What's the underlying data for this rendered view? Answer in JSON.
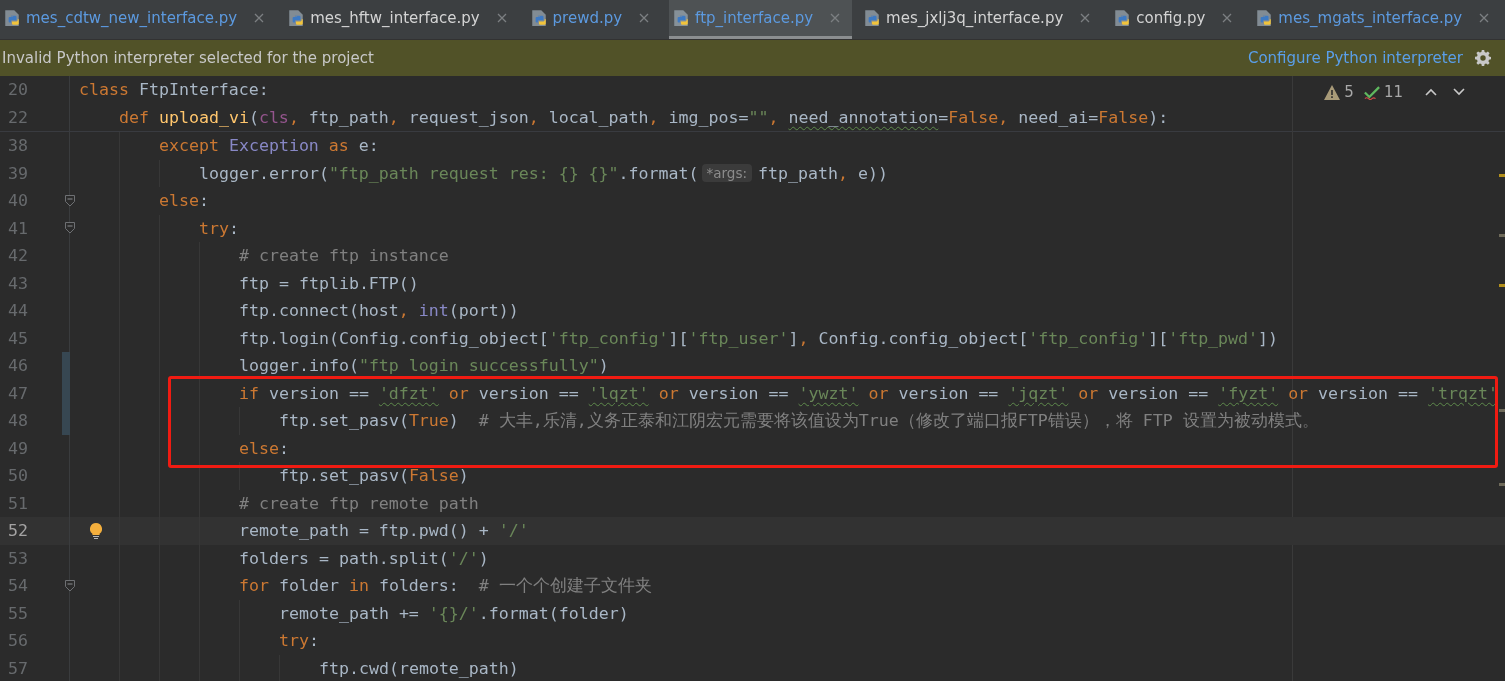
{
  "tabs": [
    {
      "label": "mes_cdtw_new_interface.py",
      "selected": false,
      "color": "#5c9ae0"
    },
    {
      "label": "mes_hftw_interface.py",
      "selected": false,
      "color": "#d4d4d4"
    },
    {
      "label": "prewd.py",
      "selected": false,
      "color": "#5c9ae0"
    },
    {
      "label": "ftp_interface.py",
      "selected": true,
      "color": "#5c9ae0"
    },
    {
      "label": "mes_jxlj3q_interface.py",
      "selected": false,
      "color": "#d4d4d4"
    },
    {
      "label": "config.py",
      "selected": false,
      "color": "#d4d4d4"
    },
    {
      "label": "mes_mgats_interface.py",
      "selected": false,
      "color": "#5c9ae0"
    }
  ],
  "banner": {
    "message": "Invalid Python interpreter selected for the project",
    "link": "Configure Python interpreter"
  },
  "inspections": {
    "warnings": "5",
    "checks": "11"
  },
  "sticky_lines": [
    {
      "number": "20",
      "tokens": [
        {
          "text": "class",
          "kind": "kw"
        },
        {
          "text": " FtpInterface:",
          "kind": "plain"
        }
      ],
      "children": [
        {
          "number": "22",
          "tokens": [
            {
              "text": "def",
              "kind": "kw"
            },
            {
              "text": " upload_vi",
              "kind": "fn"
            },
            {
              "text": "(",
              "kind": "plain"
            },
            {
              "text": "cls",
              "kind": "self"
            },
            {
              "text": ",",
              "kind": "kw"
            },
            {
              "text": " ftp_path",
              "kind": "plain"
            },
            {
              "text": ",",
              "kind": "kw"
            },
            {
              "text": " request_json",
              "kind": "plain"
            },
            {
              "text": ",",
              "kind": "kw"
            },
            {
              "text": " local_path",
              "kind": "plain"
            },
            {
              "text": ",",
              "kind": "kw"
            },
            {
              "text": " img_pos=",
              "kind": "plain"
            },
            {
              "text": "\"\"",
              "kind": "str"
            },
            {
              "text": ", ",
              "kind": "kw"
            },
            {
              "text": "need_annotation",
              "kind": "plain",
              "squiggle": true
            },
            {
              "text": "=",
              "kind": "plain"
            },
            {
              "text": "False",
              "kind": "kw"
            },
            {
              "text": ",",
              "kind": "kw"
            },
            {
              "text": " need_ai=",
              "kind": "plain"
            },
            {
              "text": "False",
              "kind": "kw"
            },
            {
              "text": "):",
              "kind": "plain"
            }
          ]
        }
      ]
    }
  ],
  "lines": [
    {
      "number": "38",
      "fold": false,
      "changed": false,
      "current": false,
      "bulb": false,
      "tokens": [
        {
          "text": "except",
          "kind": "kw"
        },
        {
          "text": " Exception",
          "kind": "builtin"
        },
        {
          "text": " as",
          "kind": "kw"
        },
        {
          "text": " e:",
          "kind": "plain"
        }
      ],
      "children": [
        {
          "number": "39",
          "fold": false,
          "changed": false,
          "current": false,
          "bulb": false,
          "tokens": [
            {
              "text": "logger.error(",
              "kind": "plain"
            },
            {
              "text": "\"ftp_path request res: {} {}\"",
              "kind": "str"
            },
            {
              "text": ".format(",
              "kind": "plain"
            },
            {
              "text": "*args:",
              "kind": "hint"
            },
            {
              "text": "ftp_path",
              "kind": "plain"
            },
            {
              "text": ",",
              "kind": "kw"
            },
            {
              "text": " e))",
              "kind": "plain"
            }
          ]
        }
      ]
    },
    {
      "number": "40",
      "fold": true,
      "changed": false,
      "current": false,
      "bulb": false,
      "tokens": [
        {
          "text": "else",
          "kind": "kw"
        },
        {
          "text": ":",
          "kind": "plain"
        }
      ],
      "children": [
        {
          "number": "41",
          "fold": true,
          "changed": false,
          "current": false,
          "bulb": false,
          "tokens": [
            {
              "text": "try",
              "kind": "kw"
            },
            {
              "text": ":",
              "kind": "plain"
            }
          ],
          "children": [
            {
              "number": "42",
              "fold": false,
              "changed": false,
              "current": false,
              "bulb": false,
              "tokens": [
                {
                  "text": "# create ftp instance",
                  "kind": "cmt"
                }
              ]
            },
            {
              "number": "43",
              "fold": false,
              "changed": false,
              "current": false,
              "bulb": false,
              "tokens": [
                {
                  "text": "ftp = ftplib.FTP()",
                  "kind": "plain"
                }
              ]
            },
            {
              "number": "44",
              "fold": false,
              "changed": false,
              "current": false,
              "bulb": false,
              "tokens": [
                {
                  "text": "ftp.connect(host",
                  "kind": "plain"
                },
                {
                  "text": ",",
                  "kind": "kw"
                },
                {
                  "text": " int",
                  "kind": "builtin"
                },
                {
                  "text": "(port))",
                  "kind": "plain"
                }
              ]
            },
            {
              "number": "45",
              "fold": false,
              "changed": false,
              "current": false,
              "bulb": false,
              "tokens": [
                {
                  "text": "ftp.login(Config.config_object[",
                  "kind": "plain"
                },
                {
                  "text": "'ftp_config'",
                  "kind": "str"
                },
                {
                  "text": "][",
                  "kind": "plain"
                },
                {
                  "text": "'ftp_user'",
                  "kind": "str"
                },
                {
                  "text": "]",
                  "kind": "plain"
                },
                {
                  "text": ",",
                  "kind": "kw"
                },
                {
                  "text": " Config.config_object[",
                  "kind": "plain"
                },
                {
                  "text": "'ftp_config'",
                  "kind": "str"
                },
                {
                  "text": "][",
                  "kind": "plain"
                },
                {
                  "text": "'ftp_pwd'",
                  "kind": "str"
                },
                {
                  "text": "])",
                  "kind": "plain"
                }
              ]
            },
            {
              "number": "46",
              "fold": false,
              "changed": true,
              "current": false,
              "bulb": false,
              "tokens": [
                {
                  "text": "logger.info(",
                  "kind": "plain"
                },
                {
                  "text": "\"ftp login successfully\"",
                  "kind": "str"
                },
                {
                  "text": ")",
                  "kind": "plain"
                }
              ]
            },
            {
              "number": "47",
              "fold": false,
              "changed": true,
              "current": false,
              "bulb": false,
              "tokens": [
                {
                  "text": "if",
                  "kind": "kw"
                },
                {
                  "text": " version == ",
                  "kind": "plain"
                },
                {
                  "text": "'dfzt'",
                  "kind": "str",
                  "squiggle": true
                },
                {
                  "text": " or",
                  "kind": "kw"
                },
                {
                  "text": " version == ",
                  "kind": "plain"
                },
                {
                  "text": "'lqzt'",
                  "kind": "str",
                  "squiggle": true
                },
                {
                  "text": " or",
                  "kind": "kw"
                },
                {
                  "text": " version == ",
                  "kind": "plain"
                },
                {
                  "text": "'ywzt'",
                  "kind": "str",
                  "squiggle": true
                },
                {
                  "text": " or",
                  "kind": "kw"
                },
                {
                  "text": " version == ",
                  "kind": "plain"
                },
                {
                  "text": "'jqzt'",
                  "kind": "str",
                  "squiggle": true
                },
                {
                  "text": " or",
                  "kind": "kw"
                },
                {
                  "text": " version == ",
                  "kind": "plain"
                },
                {
                  "text": "'fyzt'",
                  "kind": "str",
                  "squiggle": true
                },
                {
                  "text": " or",
                  "kind": "kw"
                },
                {
                  "text": " version == ",
                  "kind": "plain"
                },
                {
                  "text": "'trqzt'",
                  "kind": "str",
                  "squiggle": true
                }
              ],
              "children": [
                {
                  "number": "48",
                  "fold": false,
                  "changed": true,
                  "current": false,
                  "bulb": false,
                  "tokens": [
                    {
                      "text": "ftp.set_pasv(",
                      "kind": "plain"
                    },
                    {
                      "text": "True",
                      "kind": "kw"
                    },
                    {
                      "text": ")  ",
                      "kind": "plain"
                    },
                    {
                      "text": "# 大丰,乐清,义务正泰和江阴宏元需要将该值设为True（修改了端口报FTP错误），将 FTP 设置为被动模式。",
                      "kind": "cmt"
                    }
                  ]
                }
              ]
            },
            {
              "number": "49",
              "fold": false,
              "changed": false,
              "current": false,
              "bulb": false,
              "tokens": [
                {
                  "text": "else",
                  "kind": "kw"
                },
                {
                  "text": ":",
                  "kind": "plain"
                }
              ],
              "children": [
                {
                  "number": "50",
                  "fold": false,
                  "changed": false,
                  "current": false,
                  "bulb": false,
                  "tokens": [
                    {
                      "text": "ftp.set_pasv(",
                      "kind": "plain"
                    },
                    {
                      "text": "False",
                      "kind": "kw"
                    },
                    {
                      "text": ")",
                      "kind": "plain"
                    }
                  ]
                }
              ]
            },
            {
              "number": "51",
              "fold": false,
              "changed": false,
              "current": false,
              "bulb": false,
              "tokens": [
                {
                  "text": "# create ftp remote path",
                  "kind": "cmt"
                }
              ]
            },
            {
              "number": "52",
              "fold": false,
              "changed": false,
              "current": true,
              "bulb": true,
              "tokens": [
                {
                  "text": "remote_path = ftp.pwd() + ",
                  "kind": "plain"
                },
                {
                  "text": "'/'",
                  "kind": "str"
                }
              ]
            },
            {
              "number": "53",
              "fold": false,
              "changed": false,
              "current": false,
              "bulb": false,
              "tokens": [
                {
                  "text": "folders = path.split(",
                  "kind": "plain"
                },
                {
                  "text": "'/'",
                  "kind": "str"
                },
                {
                  "text": ")",
                  "kind": "plain"
                }
              ]
            },
            {
              "number": "54",
              "fold": true,
              "changed": false,
              "current": false,
              "bulb": false,
              "tokens": [
                {
                  "text": "for",
                  "kind": "kw"
                },
                {
                  "text": " folder ",
                  "kind": "plain"
                },
                {
                  "text": "in",
                  "kind": "kw"
                },
                {
                  "text": " folders:  ",
                  "kind": "plain"
                },
                {
                  "text": "# 一个个创建子文件夹",
                  "kind": "cmt"
                }
              ],
              "children": [
                {
                  "number": "55",
                  "fold": false,
                  "changed": false,
                  "current": false,
                  "bulb": false,
                  "tokens": [
                    {
                      "text": "remote_path += ",
                      "kind": "plain"
                    },
                    {
                      "text": "'{}/'",
                      "kind": "str"
                    },
                    {
                      "text": ".format(folder)",
                      "kind": "plain"
                    }
                  ]
                },
                {
                  "number": "56",
                  "fold": false,
                  "changed": false,
                  "current": false,
                  "bulb": false,
                  "tokens": [
                    {
                      "text": "try",
                      "kind": "kw"
                    },
                    {
                      "text": ":",
                      "kind": "plain"
                    }
                  ],
                  "children": [
                    {
                      "number": "57",
                      "fold": false,
                      "changed": false,
                      "current": false,
                      "bulb": false,
                      "tokens": [
                        {
                          "text": "ftp.cwd(remote_path)",
                          "kind": "plain"
                        }
                      ]
                    }
                  ]
                }
              ]
            }
          ]
        }
      ]
    }
  ]
}
